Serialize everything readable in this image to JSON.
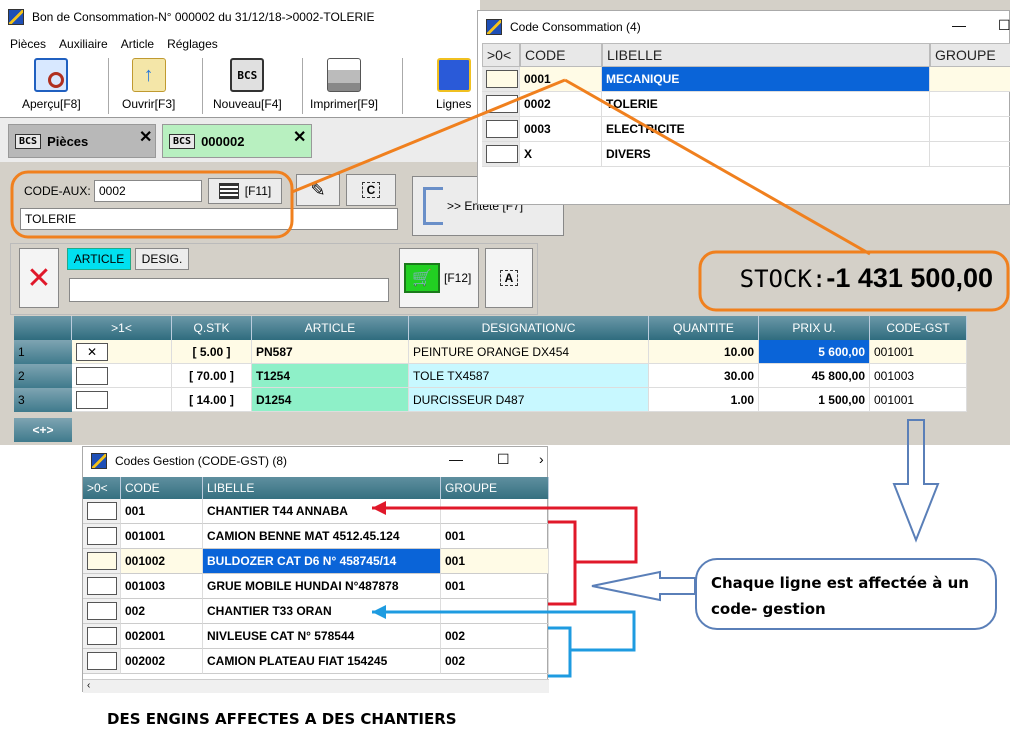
{
  "main_window": {
    "title": "Bon de Consommation-N° 000002 du 31/12/18->0002-TOLERIE",
    "menu": [
      "Pièces",
      "Auxiliaire",
      "Article",
      "Réglages"
    ],
    "toolbar": [
      {
        "label": "Aperçu[F8]",
        "icon": "preview-icon"
      },
      {
        "label": "Ouvrir[F3]",
        "icon": "open-icon"
      },
      {
        "label": "Nouveau[F4]",
        "icon": "bcs-icon"
      },
      {
        "label": "Imprimer[F9]",
        "icon": "printer-icon"
      },
      {
        "label": "Lignes",
        "icon": "lines-icon"
      }
    ],
    "bcs_text": "BCS",
    "tabs": [
      {
        "label": "Pièces",
        "close": "✕"
      },
      {
        "label": "000002",
        "close": "✕"
      }
    ],
    "code_aux_label": "CODE-AUX:",
    "code_aux_value": "0002",
    "f11": "[F11]",
    "code_aux_desc": "TOLERIE",
    "entete_label": ">> Entête [F7]",
    "article_tab": "ARTICLE",
    "desig_tab": "DESIG.",
    "f12": "[F12]",
    "stock_label": "STOCK:",
    "stock_value": "-1 431 500,00"
  },
  "lines_grid": {
    "headers": [
      ">1<",
      "Q.STK",
      "ARTICLE",
      "DESIGNATION/C",
      "QUANTITE",
      "PRIX U.",
      "CODE-GST"
    ],
    "rows": [
      {
        "n": "1",
        "qstk": "[ 5.00 ]",
        "article": "PN587",
        "designation": "PEINTURE ORANGE DX454",
        "quantite": "10.00",
        "prix": "5 600,00",
        "code_gst": "001001"
      },
      {
        "n": "2",
        "qstk": "[ 70.00 ]",
        "article": "T1254",
        "designation": "TOLE TX4587",
        "quantite": "30.00",
        "prix": "45 800,00",
        "code_gst": "001003"
      },
      {
        "n": "3",
        "qstk": "[ 14.00 ]",
        "article": "D1254",
        "designation": "DURCISSEUR D487",
        "quantite": "1.00",
        "prix": "1 500,00",
        "code_gst": "001001"
      }
    ],
    "footer": "<+>"
  },
  "code_consommation": {
    "title": "Code Consommation (4)",
    "headers": [
      ">0<",
      "CODE",
      "LIBELLE",
      "GROUPE"
    ],
    "rows": [
      {
        "code": "0001",
        "libelle": "MECANIQUE"
      },
      {
        "code": "0002",
        "libelle": "TOLERIE"
      },
      {
        "code": "0003",
        "libelle": "ELECTRICITE"
      },
      {
        "code": "X",
        "libelle": "DIVERS"
      }
    ]
  },
  "codes_gestion": {
    "title": "Codes Gestion (CODE-GST) (8)",
    "headers": [
      ">0<",
      "CODE",
      "LIBELLE",
      "GROUPE"
    ],
    "rows": [
      {
        "code": "001",
        "libelle": "CHANTIER T44 ANNABA",
        "groupe": ""
      },
      {
        "code": "001001",
        "libelle": "CAMION BENNE MAT 4512.45.124",
        "groupe": "001"
      },
      {
        "code": "001002",
        "libelle": "BULDOZER CAT D6  N° 458745/14",
        "groupe": "001"
      },
      {
        "code": "001003",
        "libelle": "GRUE MOBILE HUNDAI N°487878",
        "groupe": "001"
      },
      {
        "code": "002",
        "libelle": "CHANTIER  T33 ORAN",
        "groupe": ""
      },
      {
        "code": "002001",
        "libelle": "NIVLEUSE CAT N° 578544",
        "groupe": "002"
      },
      {
        "code": "002002",
        "libelle": "CAMION PLATEAU FIAT 154245",
        "groupe": "002"
      }
    ]
  },
  "callout": "Chaque ligne est affectée à un code- gestion",
  "caption": "DES ENGINS AFFECTES A DES CHANTIERS",
  "colors": {
    "highlight_blue": "#0a64d8",
    "grid_header": "#3f7a8c",
    "orange": "#f0801e",
    "red": "#e0182a",
    "cyan": "#1e9be0",
    "callout_blue": "#5a7fb8",
    "green_cell": "#8ef0c8",
    "cyan_cell": "#c8f8ff"
  }
}
